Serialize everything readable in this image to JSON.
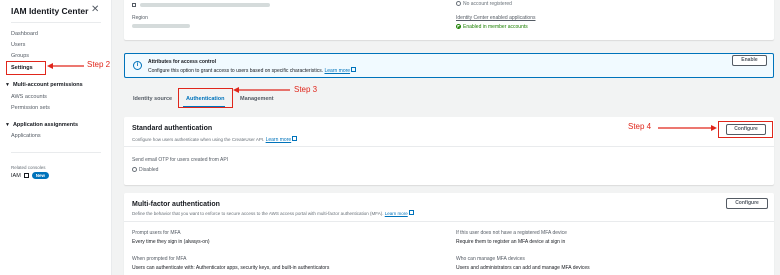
{
  "sidebar": {
    "title": "IAM Identity Center",
    "links": {
      "dashboard": "Dashboard",
      "users": "Users",
      "groups": "Groups",
      "settings": "Settings"
    },
    "multi_account": {
      "heading": "Multi-account permissions",
      "aws_accounts": "AWS accounts",
      "permission_sets": "Permission sets"
    },
    "app_assignments": {
      "heading": "Application assignments",
      "applications": "Applications"
    },
    "related_label": "Related consoles",
    "iam_label": "IAM",
    "new_badge": "New"
  },
  "details": {
    "region_label": "Region",
    "no_account": "No account registered",
    "apps_label": "Identity Center enabled applications",
    "apps_value": "Enabled in member accounts"
  },
  "abac": {
    "title": "Attributes for access control",
    "desc": "Configure this option to grant access to users based on specific characteristics.",
    "learn_more": "Learn more",
    "enable_button": "Enable"
  },
  "tabs": {
    "identity_source": "Identity source",
    "authentication": "Authentication",
    "management": "Management"
  },
  "standard_auth": {
    "title": "Standard authentication",
    "desc": "Configure how users authenticate when using the CreateUser API.",
    "learn_more": "Learn more",
    "configure_button": "Configure",
    "otp_label": "Send email OTP for users created from API",
    "otp_value": "Disabled"
  },
  "mfa": {
    "title": "Multi-factor authentication",
    "desc": "Define the behavior that you want to enforce to secure access to the AWS access portal with multi-factor authentication (MFA).",
    "learn_more": "Learn more",
    "configure_button": "Configure",
    "prompt_label": "Prompt users for MFA",
    "prompt_value": "Every time they sign in (always-on)",
    "when_prompted_label": "When prompted for MFA",
    "when_prompted_value": "Users can authenticate with: Authenticator apps, security keys, and built-in authenticators",
    "no_device_label": "If this user does not have a registered MFA device",
    "no_device_value": "Require them to register an MFA device at sign in",
    "who_manage_label": "Who can manage MFA devices",
    "who_manage_value": "Users and administrators can add and manage MFA devices"
  },
  "annotations": {
    "step2": "Step 2",
    "step3": "Step 3",
    "step4": "Step 4"
  },
  "colors": {
    "accent": "#0073bb",
    "annotation": "#e0261b",
    "success": "#1d8102"
  }
}
